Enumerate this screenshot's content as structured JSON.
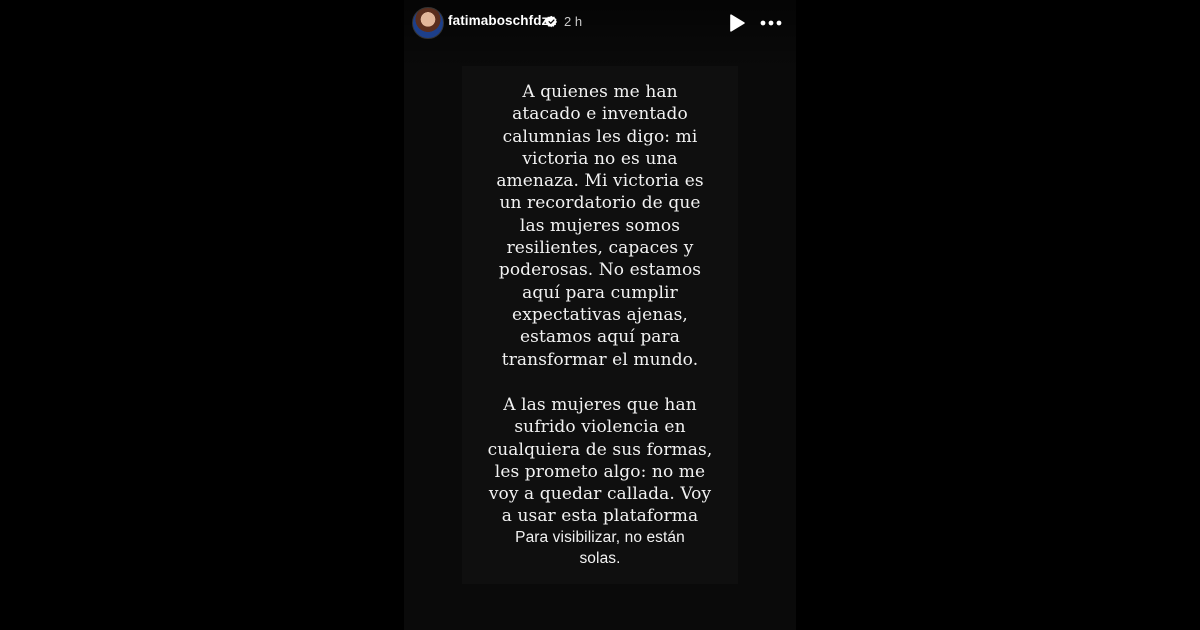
{
  "header": {
    "username": "fatimaboschfdz",
    "time": "2 h"
  },
  "icons": {
    "avatar": "profile-photo",
    "verified": "verified-badge-icon",
    "play": "play-icon",
    "more": "more-icon"
  },
  "story_text": {
    "paragraph1": "A quienes me han\natacado e inventado\ncalumnias les digo: mi\nvictoria no es una\namenaza. Mi victoria es\nun recordatorio de que\nlas mujeres somos\nresilientes, capaces y\npoderosas. No estamos\naquí para cumplir\nexpectativas ajenas,\nestamos aquí para\ntransformar el mundo.",
    "paragraph2": "A las mujeres que han\nsufrido violencia en\ncualquiera de sus formas,\nles prometo algo: no me\nvoy a quedar callada. Voy\na usar esta plataforma",
    "paragraph3": "Para visibilizar, no están\nsolas."
  }
}
